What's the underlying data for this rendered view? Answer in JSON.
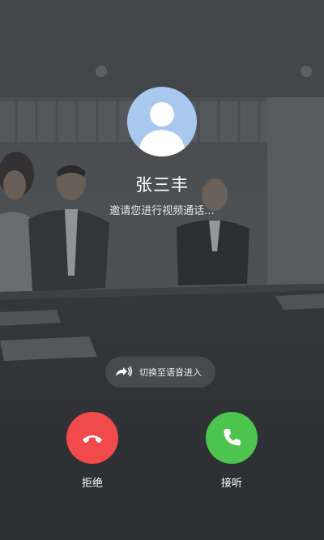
{
  "caller": {
    "name": "张三丰",
    "status_text": "邀请您进行视频通话..."
  },
  "actions": {
    "switch_to_voice_label": "切换至语音进入",
    "decline_label": "拒绝",
    "accept_label": "接听"
  },
  "icons": {
    "avatar": "person-silhouette-icon",
    "switch": "forward-arrow-sound-icon",
    "decline": "hang-up-phone-icon",
    "accept": "phone-handset-icon"
  },
  "colors": {
    "decline": "#f04a4a",
    "accept": "#4cc44e",
    "avatar_bg": "#a8c8ee"
  }
}
